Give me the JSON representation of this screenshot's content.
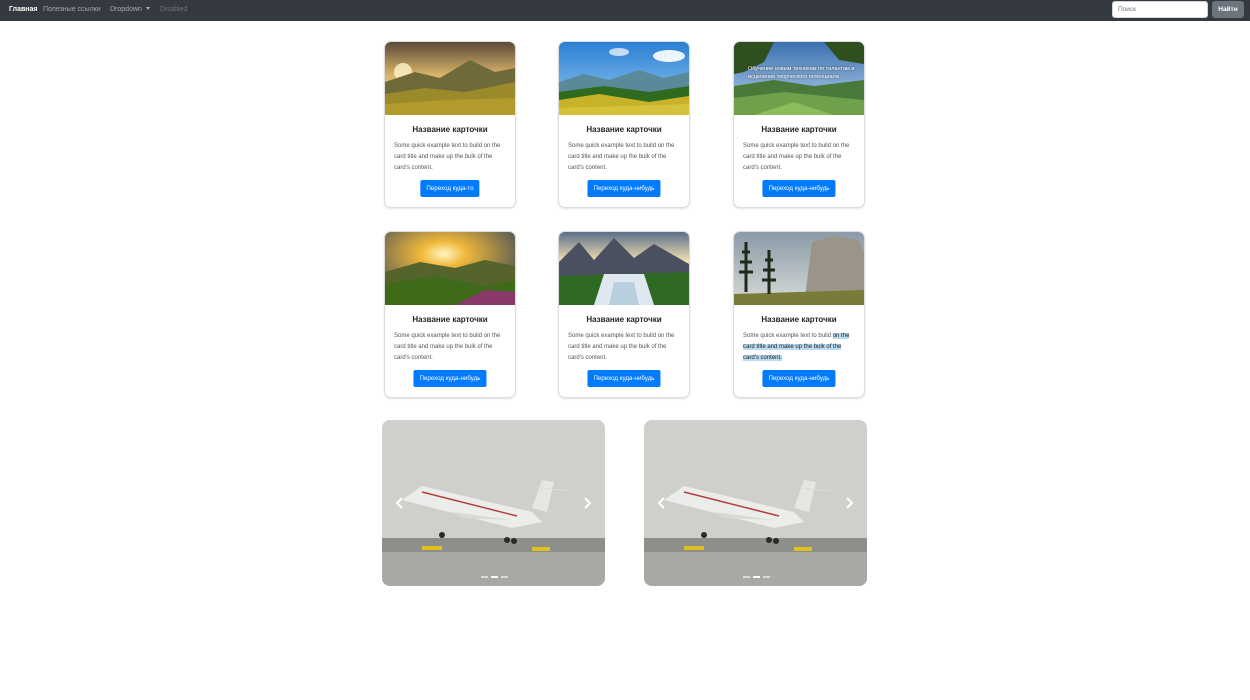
{
  "navbar": {
    "links": [
      {
        "label": "Главная",
        "active": true
      },
      {
        "label": "Полезные ссылки"
      },
      {
        "label": "Dropdown"
      },
      {
        "label": "Disabled",
        "disabled": true
      }
    ],
    "search_placeholder": "Поиск",
    "search_button": "Найти"
  },
  "cards": [
    {
      "title": "Название карточки",
      "text": "Some quick example text to build on the card title and make up the bulk of the card's content.",
      "button": "Переход куда-то",
      "image": "mountain-sunset-landscape"
    },
    {
      "title": "Название карточки",
      "text": "Some quick example text to build on the card title and make up the bulk of the card's content.",
      "button": "Переход куда-нибудь",
      "image": "valley-meadow-landscape"
    },
    {
      "title": "Название карточки",
      "text": "Some quick example text to build on the card title and make up the bulk of the card's content.",
      "button": "Переход куда-нибудь",
      "image": "green-valley-landscape",
      "overlay_caption": "Обучение новым техникам по талантам и исцеление творческого потенциала"
    },
    {
      "title": "Название карточки",
      "text": "Some quick example text to build on the card title and make up the bulk of the card's content.",
      "button": "Переход куда-нибудь",
      "image": "sunrise-hills-landscape"
    },
    {
      "title": "Название карточки",
      "text": "Some quick example text to build on the card title and make up the bulk of the card's content.",
      "button": "Переход куда-нибудь",
      "image": "waterfall-landscape"
    },
    {
      "title": "Название карточки",
      "text_lead": "Some quick example text to build",
      "text_selected": "on the card title and make up the bulk of the card's content.",
      "button": "Переход куда-нибудь",
      "image": "yosemite-cliff-landscape"
    }
  ],
  "carousels": [
    {
      "image": "airliner-takeoff",
      "prev_icon": "chevron-left-icon",
      "next_icon": "chevron-right-icon",
      "slides": 3,
      "active_slide": 2
    },
    {
      "image": "airliner-takeoff",
      "prev_icon": "chevron-left-icon",
      "next_icon": "chevron-right-icon",
      "slides": 3,
      "active_slide": 2
    }
  ],
  "colors": {
    "navbar_bg": "#343a40",
    "primary": "#007bff",
    "secondary": "#6c757d",
    "selection": "#b9dcf2"
  }
}
